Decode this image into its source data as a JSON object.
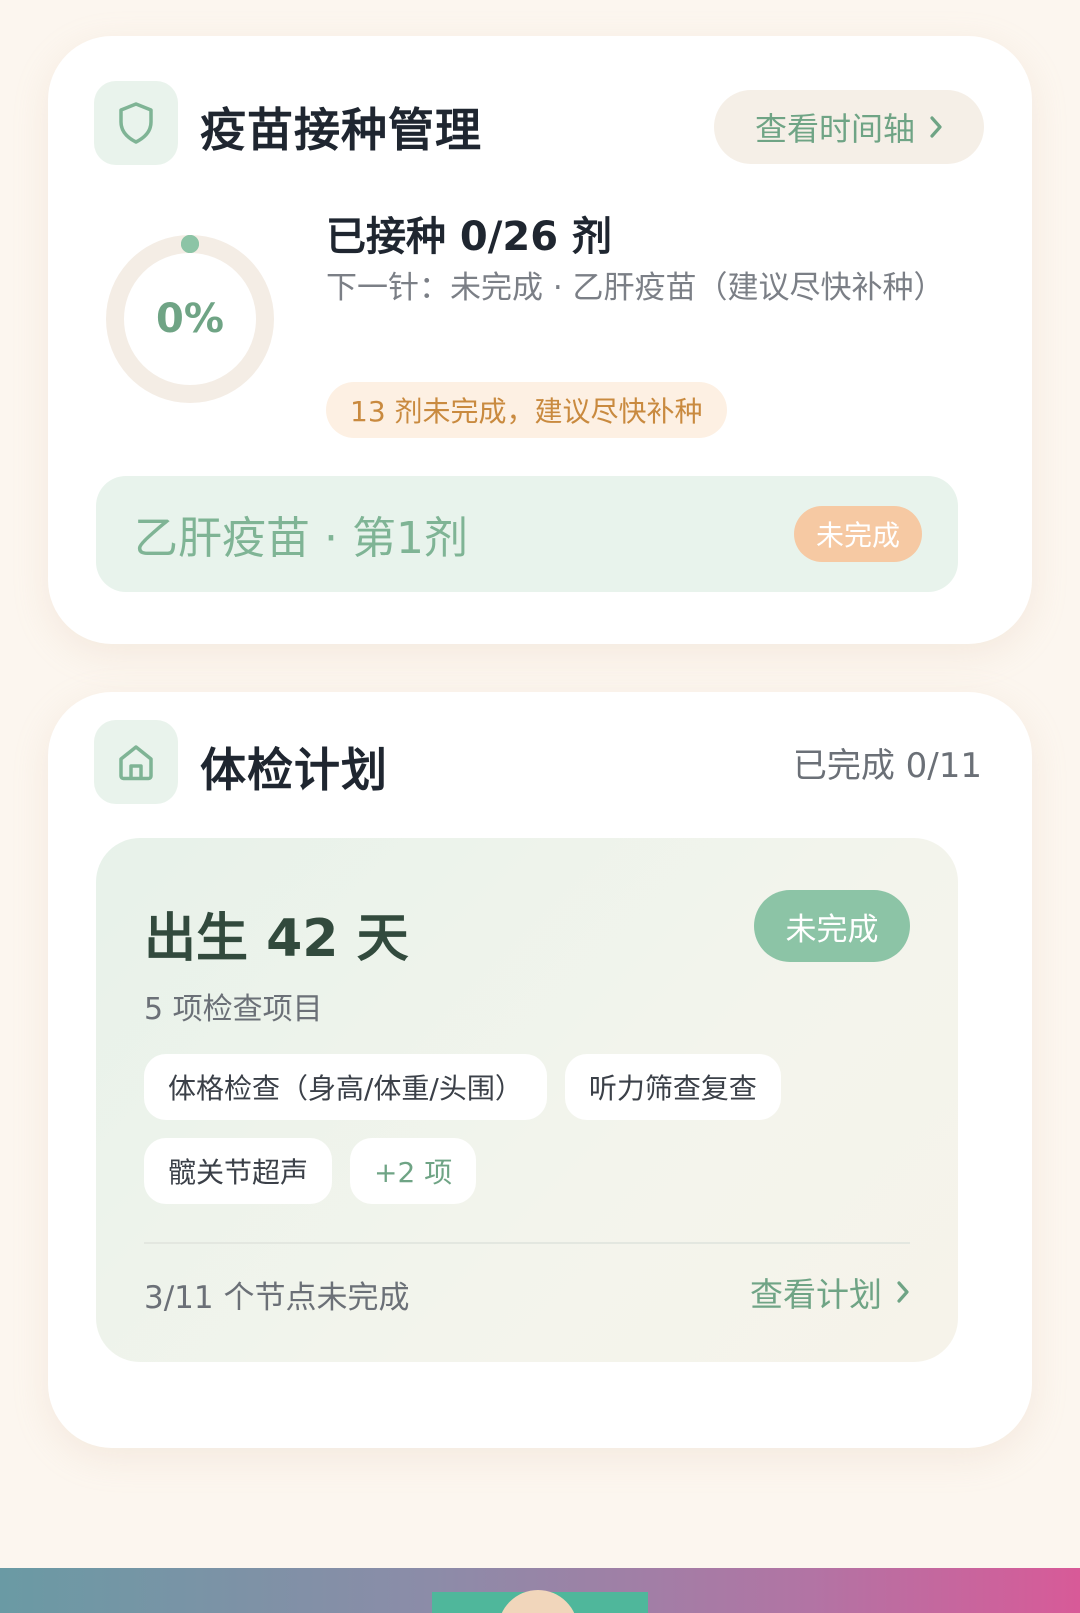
{
  "vaccine": {
    "title": "疫苗接种管理",
    "timeline_label": "查看时间轴",
    "progress_percent": 0,
    "progress_text": "0%",
    "dose_summary": "已接种 0/26 剂",
    "next_dose": "下一针：未完成 · 乙肝疫苗（建议尽快补种）",
    "warning": "13 剂未完成，建议尽快补种",
    "current_dose": {
      "label": "乙肝疫苗 · 第1剂",
      "status": "未完成"
    },
    "icon": "shield-icon"
  },
  "checkup": {
    "title": "体检计划",
    "completed": "已完成 0/11",
    "icon": "home-icon",
    "plan": {
      "title": "出生 42 天",
      "status": "未完成",
      "item_count": "5 项检查项目",
      "items": [
        "体格检查（身高/体重/头围）",
        "听力筛查复查",
        "髋关节超声"
      ],
      "more": "+2 项",
      "footer": "3/11 个节点未完成",
      "link": "查看计划"
    }
  },
  "colors": {
    "accent_green": "#6fa485",
    "badge_green": "#8cc4a6",
    "badge_peach": "#f6c9a3",
    "warning_text": "#c98a3f"
  }
}
